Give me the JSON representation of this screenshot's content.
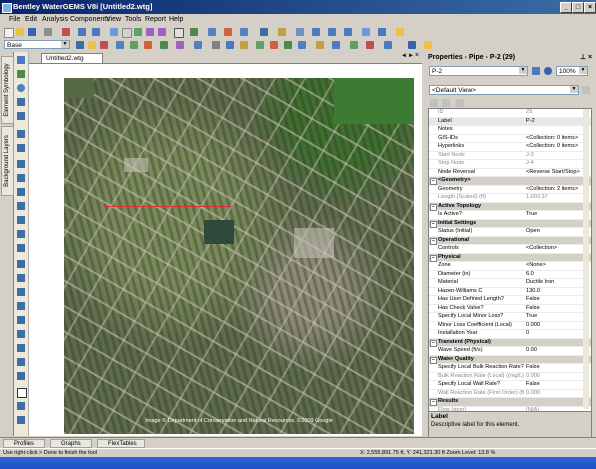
{
  "window": {
    "title": "Bentley WaterGEMS V8i [Untitled2.wtg]",
    "min": "_",
    "max": "□",
    "close": "×"
  },
  "menu": [
    "File",
    "Edit",
    "Analysis",
    "Components",
    "View",
    "Tools",
    "Report",
    "Help"
  ],
  "toolbar": {
    "scenario_value": "Base",
    "zoom_value": "100%"
  },
  "left_tabs": [
    "Element Symbology",
    "Background Layers"
  ],
  "document": {
    "tab_label": "Untitled2.wtg",
    "nav_prev": "◄",
    "nav_next": "►",
    "close": "×"
  },
  "map": {
    "credit": "Image © Department of Conservation and Natural Resources, ©2009 Google"
  },
  "properties": {
    "header": "Properties - Pipe - P-2 (29)",
    "element_value": "P-2",
    "zoom_value": "100%",
    "view_value": "<Default View>",
    "rows": [
      {
        "name": "ID",
        "value": "29",
        "kind": "dim"
      },
      {
        "name": "Label",
        "value": "P-2",
        "kind": "sel"
      },
      {
        "name": "Notes",
        "value": "",
        "kind": ""
      },
      {
        "name": "GIS-IDs",
        "value": "<Collection: 0 items>",
        "kind": ""
      },
      {
        "name": "Hyperlinks",
        "value": "<Collection: 0 items>",
        "kind": ""
      },
      {
        "name": "Start Node",
        "value": "J-3",
        "kind": "dim"
      },
      {
        "name": "Stop Node",
        "value": "J-4",
        "kind": "dim"
      },
      {
        "name": "Node Reversal",
        "value": "<Reverse Start/Stop>",
        "kind": ""
      },
      {
        "name": "<Geometry>",
        "value": "",
        "kind": "cat"
      },
      {
        "name": "Geometry",
        "value": "<Collection: 2 items>",
        "kind": ""
      },
      {
        "name": "Length (Scaled) (ft)",
        "value": "1,003.37",
        "kind": "dim"
      },
      {
        "name": "Active Topology",
        "value": "",
        "kind": "cat"
      },
      {
        "name": "Is Active?",
        "value": "True",
        "kind": ""
      },
      {
        "name": "Initial Settings",
        "value": "",
        "kind": "cat"
      },
      {
        "name": "Status (Initial)",
        "value": "Open",
        "kind": ""
      },
      {
        "name": "Operational",
        "value": "",
        "kind": "cat"
      },
      {
        "name": "Controls",
        "value": "<Collection>",
        "kind": ""
      },
      {
        "name": "Physical",
        "value": "",
        "kind": "cat"
      },
      {
        "name": "Zone",
        "value": "<None>",
        "kind": ""
      },
      {
        "name": "Diameter (in)",
        "value": "6.0",
        "kind": ""
      },
      {
        "name": "Material",
        "value": "Ductile Iron",
        "kind": ""
      },
      {
        "name": "Hazen-Williams C",
        "value": "130.0",
        "kind": ""
      },
      {
        "name": "Has User Defined Length?",
        "value": "False",
        "kind": ""
      },
      {
        "name": "Has Check Valve?",
        "value": "False",
        "kind": ""
      },
      {
        "name": "Specify Local Minor Loss?",
        "value": "True",
        "kind": ""
      },
      {
        "name": "Minor Loss Coefficient (Local)",
        "value": "0.000",
        "kind": ""
      },
      {
        "name": "Installation Year",
        "value": "0",
        "kind": ""
      },
      {
        "name": "Transient (Physical)",
        "value": "",
        "kind": "cat"
      },
      {
        "name": "Wave Speed (ft/s)",
        "value": "0.00",
        "kind": ""
      },
      {
        "name": "Water Quality",
        "value": "",
        "kind": "cat"
      },
      {
        "name": "Specify Local Bulk Reaction Rate?",
        "value": "False",
        "kind": ""
      },
      {
        "name": "Bulk Reaction Rate (Local) ((mg/L)^(1-n)/s)",
        "value": "0.000",
        "kind": "dim"
      },
      {
        "name": "Specify Local Wall Rate?",
        "value": "False",
        "kind": ""
      },
      {
        "name": "Wall Reaction Rate (First Order) (ft/s)",
        "value": "0.000",
        "kind": "dim"
      },
      {
        "name": "Results",
        "value": "",
        "kind": "cat"
      },
      {
        "name": "Flow (gpm)",
        "value": "(N/A)",
        "kind": "dim"
      },
      {
        "name": "Velocity (ft/s)",
        "value": "(N/A)",
        "kind": "dim"
      }
    ],
    "desc_title": "Label",
    "desc_text": "Descriptive label for this element."
  },
  "bottom_tabs": [
    "Profiles",
    "Graphs",
    "FlexTables"
  ],
  "status": {
    "left": "Use right-click > Done to finish the tool",
    "right": "X: 2,555,891.75 ft, Y: 241,321.30 ft   Zoom Level: 13.8 %"
  }
}
